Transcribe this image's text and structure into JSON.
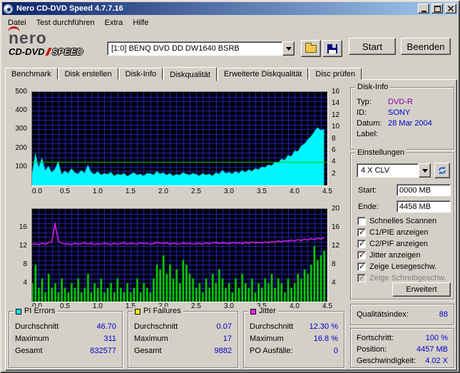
{
  "window": {
    "title": "Nero CD-DVD Speed 4.7.7.16"
  },
  "menu": {
    "items": [
      "Datei",
      "Test durchführen",
      "Extra",
      "Hilfe"
    ]
  },
  "logo": {
    "brand": "nero",
    "product_a": "CD-DVD",
    "product_b": "SPEED"
  },
  "toolbar": {
    "drive_select": "[1:0]  BENQ DVD DD DW1640 BSRB",
    "start_label": "Start",
    "quit_label": "Beenden"
  },
  "tabs": [
    {
      "label": "Benchmark",
      "active": false
    },
    {
      "label": "Disk erstellen",
      "active": false
    },
    {
      "label": "Disk-Info",
      "active": false
    },
    {
      "label": "Diskqualität",
      "active": true
    },
    {
      "label": "Erweiterte Diskqualität",
      "active": false
    },
    {
      "label": "Disc prüfen",
      "active": false
    }
  ],
  "disk_info": {
    "title": "Disk-Info",
    "type_color": "#8800AA",
    "rows": [
      {
        "label": "Typ:",
        "value": "DVD-R"
      },
      {
        "label": "ID:",
        "value": "SONY"
      },
      {
        "label": "Datum:",
        "value": "28 Mar 2004"
      },
      {
        "label": "Label:",
        "value": ""
      }
    ]
  },
  "settings": {
    "title": "Einstellungen",
    "speed_value": "4 X CLV",
    "start_label": "Start:",
    "start_value": "0000 MB",
    "end_label": "Ende:",
    "end_value": "4458 MB",
    "advanced_label": "Erweitert",
    "checkboxes": [
      {
        "label": "Schnelles Scannen",
        "checked": false
      },
      {
        "label": "C1/PIE anzeigen",
        "checked": true
      },
      {
        "label": "C2/PIF anzeigen",
        "checked": true
      },
      {
        "label": "Jitter anzeigen",
        "checked": true
      },
      {
        "label": "Zeige Lesegeschw.",
        "checked": true
      },
      {
        "label": "Zeige Schreibgeschw.",
        "checked": true,
        "disabled": true
      }
    ]
  },
  "quality": {
    "label": "Qualitätsindex:",
    "value": "88"
  },
  "progress": {
    "rows": [
      {
        "label": "Fortschritt:",
        "value": "100 %"
      },
      {
        "label": "Position:",
        "value": "4457 MB"
      },
      {
        "label": "Geschwindigkeit:",
        "value": "4.02 X"
      }
    ]
  },
  "stats": [
    {
      "title": "PI Errors",
      "marker_color": "#00F5FF",
      "rows": [
        {
          "label": "Durchschnitt",
          "value": "46.70"
        },
        {
          "label": "Maximum",
          "value": "311"
        },
        {
          "label": "Gesamt",
          "value": "832577"
        }
      ]
    },
    {
      "title": "PI Failures",
      "marker_color": "#FFFF00",
      "rows": [
        {
          "label": "Durchschnitt",
          "value": "0.07"
        },
        {
          "label": "Maximum",
          "value": "17"
        },
        {
          "label": "Gesamt",
          "value": "9882"
        }
      ]
    },
    {
      "title": "Jitter",
      "marker_color": "#FF22FF",
      "rows": [
        {
          "label": "Durchschnitt",
          "value": "12.30 %"
        },
        {
          "label": "Maximum",
          "value": "16.8 %"
        },
        {
          "label": "PO Ausfälle:",
          "value": "0"
        }
      ]
    }
  ],
  "colors": {
    "titlebar_left": "#0A246A",
    "titlebar_right": "#A6CAF0",
    "window_face": "#D4D0C8",
    "chart_bg": "#000000",
    "chart_grid": "#2424C8",
    "value_text": "#0000C8"
  },
  "chart_data": [
    {
      "type": "area",
      "title": "PI Errors vs Position",
      "x_unit": "GB",
      "x_start": 0,
      "x_step": 0.05,
      "xmax": 4.5,
      "xticks": [
        0,
        0.5,
        1,
        1.5,
        2,
        2.5,
        3,
        3.5,
        4,
        4.5
      ],
      "ylim_left": [
        0,
        500
      ],
      "yticks_left": [
        500,
        400,
        300,
        200,
        100
      ],
      "ylim_right": [
        0,
        16
      ],
      "yticks_right": [
        16,
        14,
        12,
        10,
        8,
        6,
        4,
        2
      ],
      "grid_x": 0.1,
      "grid_y": 25,
      "series": [
        {
          "name": "PI Errors",
          "style": "area",
          "axis": "left",
          "color": "#00F5FF",
          "values": [
            65,
            175,
            95,
            150,
            80,
            105,
            70,
            90,
            130,
            60,
            78,
            65,
            92,
            70,
            62,
            82,
            66,
            112,
            72,
            60,
            75,
            56,
            66,
            60,
            72,
            52,
            62,
            56,
            66,
            50,
            60,
            70,
            56,
            62,
            52,
            66,
            64,
            56,
            76,
            62,
            70,
            56,
            66,
            52,
            60,
            56,
            70,
            62,
            56,
            66,
            60,
            52,
            66,
            56,
            62,
            52,
            70,
            62,
            82,
            66,
            72,
            62,
            76,
            66,
            82,
            70,
            86,
            76,
            92,
            86,
            100,
            96,
            112,
            106,
            126,
            122,
            142,
            136,
            162,
            156,
            186,
            182,
            212,
            222,
            246,
            262,
            288,
            311,
            296,
            302
          ]
        },
        {
          "name": "Lesegeschwindigkeit",
          "style": "hline",
          "axis": "right",
          "color": "#00C800",
          "value": 4
        }
      ]
    },
    {
      "type": "bar",
      "title": "PI Failures and Jitter vs Position",
      "x_unit": "GB",
      "x_start": 0,
      "x_step": 0.05,
      "xmax": 4.5,
      "xticks": [
        0,
        0.5,
        1,
        1.5,
        2,
        2.5,
        3,
        3.5,
        4,
        4.5
      ],
      "ylim_left": [
        0,
        20
      ],
      "yticks_left": [
        16,
        12,
        8,
        4
      ],
      "ylim_right": [
        0,
        20
      ],
      "yticks_right": [
        20,
        16,
        12,
        8,
        4
      ],
      "grid_x": 0.1,
      "grid_y": 1,
      "series": [
        {
          "name": "PI Failures",
          "style": "bar",
          "axis": "left",
          "color": "#00DC00",
          "values": [
            4,
            8,
            3,
            5,
            2,
            6,
            3,
            4,
            2,
            5,
            3,
            2,
            4,
            3,
            5,
            2,
            3,
            6,
            2,
            4,
            3,
            5,
            2,
            3,
            4,
            2,
            5,
            3,
            2,
            4,
            2,
            3,
            5,
            2,
            4,
            3,
            2,
            5,
            8,
            7,
            10,
            6,
            8,
            5,
            7,
            4,
            9,
            8,
            6,
            5,
            3,
            4,
            2,
            5,
            3,
            6,
            4,
            7,
            5,
            3,
            4,
            2,
            5,
            3,
            6,
            4,
            3,
            5,
            2,
            4,
            3,
            5,
            4,
            6,
            3,
            5,
            4,
            2,
            5,
            3,
            4,
            6,
            5,
            7,
            6,
            8,
            12,
            9,
            10,
            11
          ]
        },
        {
          "name": "Jitter",
          "style": "line",
          "axis": "right",
          "color": "#FF22FF",
          "values": [
            12.4,
            12.5,
            12.3,
            12.6,
            12.4,
            12.7,
            12.9,
            16.8,
            13.1,
            12.6,
            12.4,
            12.5,
            12.3,
            12.6,
            12.4,
            12.5,
            12.7,
            12.4,
            12.6,
            12.3,
            12.5,
            12.4,
            12.6,
            12.5,
            12.3,
            12.6,
            12.4,
            12.5,
            12.7,
            12.4,
            12.6,
            12.5,
            12.4,
            12.7,
            12.5,
            12.6,
            12.4,
            12.5,
            12.8,
            12.6,
            12.5,
            12.7,
            12.4,
            12.6,
            12.5,
            12.4,
            12.7,
            12.5,
            12.6,
            12.4,
            12.5,
            12.6,
            12.4,
            12.7,
            12.5,
            12.6,
            12.8,
            12.5,
            12.7,
            12.6,
            12.5,
            12.8,
            12.6,
            12.7,
            12.5,
            12.8,
            12.6,
            12.9,
            12.7,
            12.8,
            12.6,
            12.9,
            12.7,
            13.0,
            12.8,
            13.1,
            12.9,
            13.2,
            13.0,
            13.3,
            13.1,
            13.4,
            13.2,
            13.5,
            13.3,
            13.6,
            13.4,
            13.7,
            13.5,
            13.8
          ]
        }
      ]
    }
  ]
}
